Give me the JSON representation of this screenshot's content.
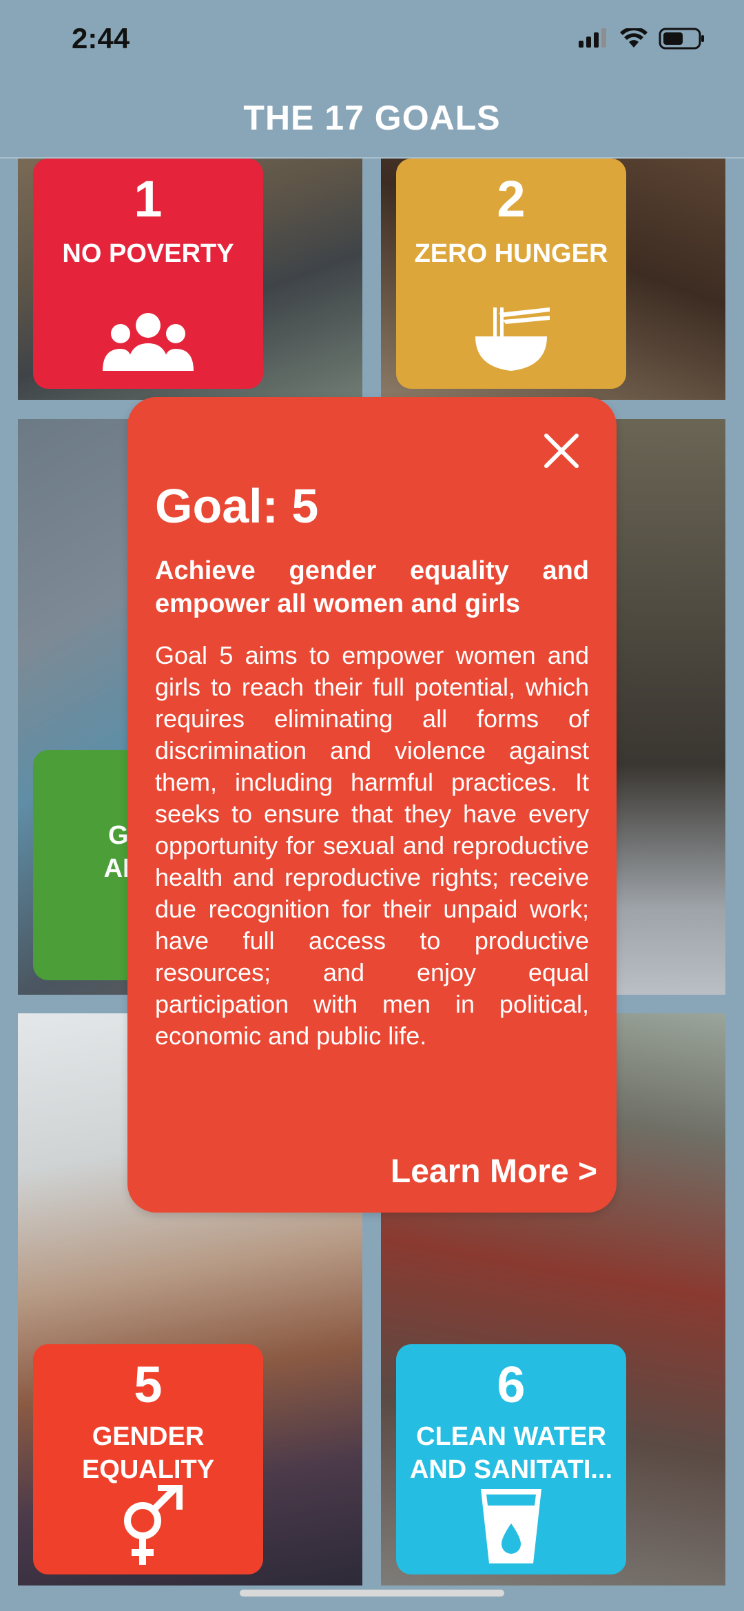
{
  "status": {
    "time": "2:44"
  },
  "header": {
    "title": "THE 17 GOALS"
  },
  "goals": [
    {
      "number": "1",
      "name": "NO POVERTY",
      "color": "#e5243b",
      "icon": "people-icon"
    },
    {
      "number": "2",
      "name": "ZERO HUNGER",
      "color": "#dda63a",
      "icon": "bowl-icon"
    },
    {
      "number": "",
      "name_line1": "GOOD",
      "name_line2": "AND W",
      "color": "#4c9f38",
      "icon": "heartbeat-icon"
    },
    {
      "number": "5",
      "name_line1": "GENDER",
      "name_line2": "EQUALITY",
      "color": "#ef402b",
      "icon": "gender-icon"
    },
    {
      "number": "6",
      "name_line1": "CLEAN WATER",
      "name_line2": "AND SANITATI...",
      "color": "#26bde2",
      "icon": "water-glass-icon"
    }
  ],
  "modal": {
    "goal_label": "Goal: 5",
    "subtitle": "Achieve gender equality and empower all women and girls",
    "body": "Goal 5 aims to empower women and girls to reach their full potential, which requires eliminating all forms of discrimination and violence against them, including harmful practices. It seeks to ensure that they have every opportunity for sexual and reproductive health and reproductive rights; receive due recognition for their unpaid work; have full access to productive resources; and enjoy equal participation with men in political, economic and public life.",
    "learn_more": "Learn More >",
    "color": "#e94834"
  }
}
